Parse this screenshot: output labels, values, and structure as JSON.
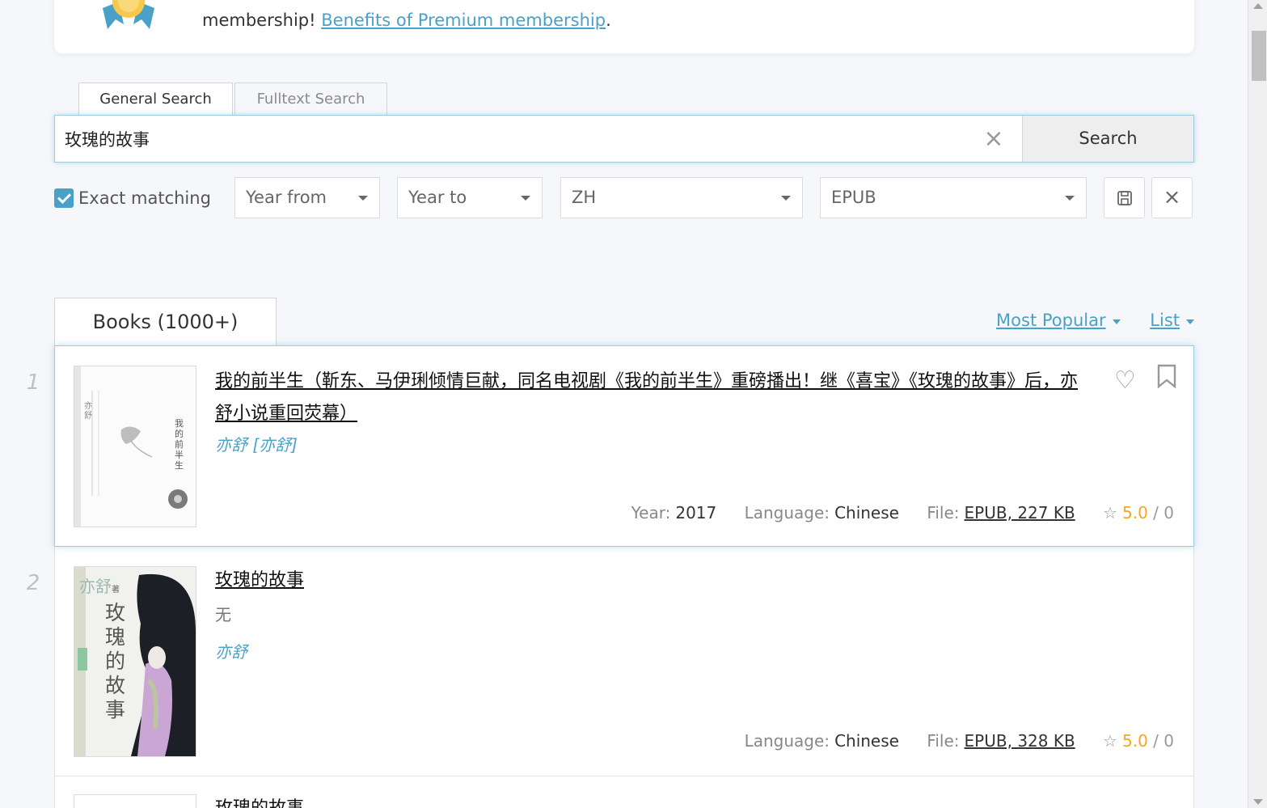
{
  "premium": {
    "text": "membership!",
    "link": "Benefits of Premium membership",
    "suffix": "."
  },
  "search_tabs": [
    {
      "label": "General Search",
      "active": true
    },
    {
      "label": "Fulltext Search",
      "active": false
    }
  ],
  "search": {
    "query": "玫瑰的故事",
    "button_label": "Search",
    "clear_icon": "×"
  },
  "filters": {
    "exact_label": "Exact matching",
    "exact_checked": true,
    "year_from": "Year from",
    "year_to": "Year to",
    "language": "ZH",
    "extension": "EPUB"
  },
  "results_tab": "Books (1000+)",
  "sort": {
    "order": "Most Popular",
    "view": "List"
  },
  "books": [
    {
      "index": "1",
      "title": "我的前半生（靳东、马伊琍倾情巨献，同名电视剧《我的前半生》重磅播出！继《喜宝》《玫瑰的故事》后，亦舒小说重回荧幕）",
      "author": "亦舒 [亦舒]",
      "publisher": "",
      "year_label": "Year:",
      "year": "2017",
      "language_label": "Language:",
      "language": "Chinese",
      "file_label": "File:",
      "file": "EPUB, 227 KB",
      "rating": "5.0",
      "rating_sep": "/",
      "rating_count": "0"
    },
    {
      "index": "2",
      "title": "玫瑰的故事",
      "author": "亦舒",
      "publisher": "无",
      "language_label": "Language:",
      "language": "Chinese",
      "file_label": "File:",
      "file": "EPUB, 328 KB",
      "rating": "5.0",
      "rating_sep": "/",
      "rating_count": "0"
    },
    {
      "index": "3",
      "title": "玫瑰的故事"
    }
  ],
  "cover1": {
    "vertical_title": "我的前半生",
    "author_vert": "亦舒"
  },
  "cover2": {
    "author": "亦舒",
    "author_suffix": "著",
    "vertical_title": "玫瑰的故事"
  },
  "colors": {
    "accent": "#49a1c8",
    "rating": "#f5a623"
  }
}
